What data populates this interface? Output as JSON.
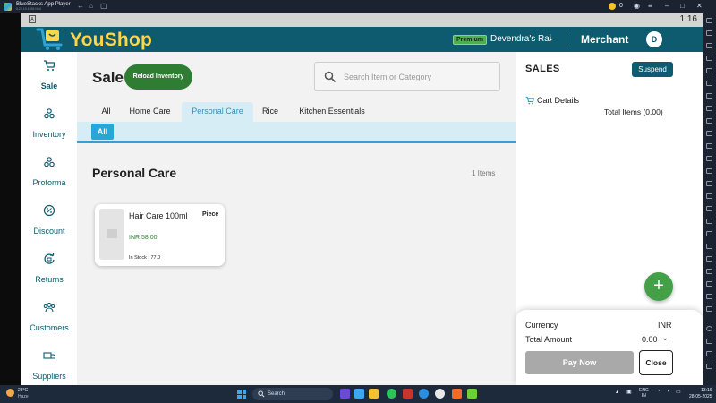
{
  "emulator": {
    "title": "BlueStacks App Player",
    "version": "5.22.10.1036  N64",
    "coins": "0",
    "android_time": "1:16"
  },
  "header": {
    "brand": "YouShop",
    "badge": "Premium",
    "user_name": "Devendra's Rai",
    "role": "Merchant",
    "avatar_letter": "D"
  },
  "sidebar": {
    "items": [
      {
        "label": "Sale",
        "icon": "cart-icon",
        "active": true
      },
      {
        "label": "Inventory",
        "icon": "boxes-icon"
      },
      {
        "label": "Proforma",
        "icon": "boxes-icon"
      },
      {
        "label": "Discount",
        "icon": "percent-icon"
      },
      {
        "label": "Returns",
        "icon": "returns-icon"
      },
      {
        "label": "Customers",
        "icon": "customers-icon"
      },
      {
        "label": "Suppliers",
        "icon": "suppliers-icon"
      }
    ]
  },
  "main": {
    "title": "Sale",
    "reload_label": "Reload Inventory",
    "search_placeholder": "Search Item or Category",
    "tabs": [
      {
        "label": "All"
      },
      {
        "label": "Home Care"
      },
      {
        "label": "Personal Care",
        "active": true
      },
      {
        "label": "Rice"
      },
      {
        "label": "Kitchen Essentials"
      }
    ],
    "subcategory_chip": "All",
    "section_title": "Personal Care",
    "items_count": "1 Items",
    "products": [
      {
        "name": "Hair Care 100ml",
        "unit": "Piece",
        "price": "INR 58.00",
        "stock": "In Stock : 77.0"
      }
    ]
  },
  "cart": {
    "title": "SALES",
    "suspend_label": "Suspend",
    "details_label": "Cart Details",
    "total_items": "Total Items (0.00)",
    "currency_label": "Currency",
    "currency_value": "INR",
    "total_amount_label": "Total Amount",
    "total_amount_value": "0.00",
    "pay_label": "Pay Now",
    "close_label": "Close",
    "fab_label": "+"
  },
  "taskbar": {
    "temperature": "28°C",
    "condition": "Haze",
    "search_label": "Search",
    "lang_line1": "ENG",
    "lang_line2": "IN",
    "time": "13:16",
    "date": "28-05-2025"
  },
  "colors": {
    "brand_teal": "#0e5a6e",
    "brand_yellow": "#ffd54a",
    "action_green": "#2e7d32",
    "tab_active_bg": "#d6edf5",
    "tab_active_text": "#3a8fb0"
  }
}
